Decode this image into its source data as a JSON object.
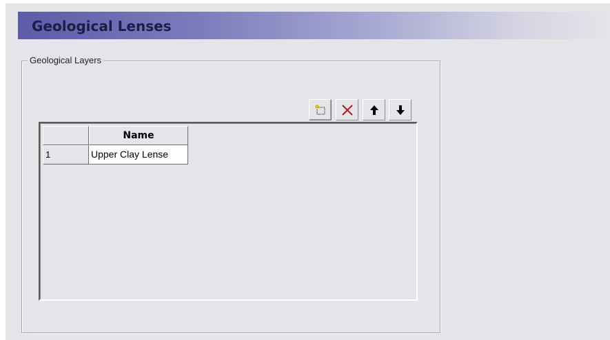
{
  "header": {
    "title": "Geological Lenses"
  },
  "group": {
    "legend": "Geological Layers"
  },
  "toolbar": {
    "buttons": [
      {
        "icon": "new-row-icon"
      },
      {
        "icon": "delete-x-icon",
        "color": "#b01818"
      },
      {
        "icon": "arrow-up-icon"
      },
      {
        "icon": "arrow-down-icon"
      }
    ]
  },
  "grid": {
    "columns": [
      "",
      "Name"
    ],
    "rows": [
      {
        "number": "1",
        "name": "Upper Clay Lense"
      }
    ]
  },
  "colors": {
    "panel_bg": "#e5e4e9",
    "header_gradient_start": "#5c5ca8",
    "header_text": "#1d1d48"
  }
}
